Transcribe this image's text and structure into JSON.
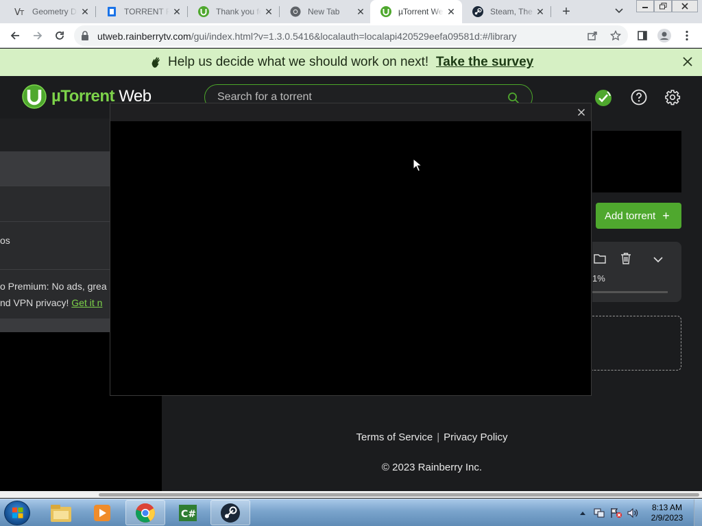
{
  "browser": {
    "tabs": [
      {
        "title": "Geometry Dash",
        "favicon": "geometry-dash-favicon",
        "active": false
      },
      {
        "title": "TORRENT FILE",
        "favicon": "document-favicon",
        "active": false
      },
      {
        "title": "Thank you for",
        "favicon": "utorrent-favicon",
        "active": false
      },
      {
        "title": "New Tab",
        "favicon": "chrome-favicon",
        "active": false
      },
      {
        "title": "µTorrent Web",
        "favicon": "utorrent-favicon",
        "active": true
      },
      {
        "title": "Steam, The Ultimate",
        "favicon": "steam-favicon",
        "active": false
      }
    ],
    "new_tab": "+",
    "url_host": "utweb.rainberrytv.com",
    "url_path": "/gui/index.html?v=1.3.0.5416&localauth=localapi420529eefa09581d:#/library"
  },
  "banner": {
    "message": "Help us decide what we should work on next!",
    "link": "Take the survey"
  },
  "app": {
    "logo_brand": "µTorrent",
    "logo_suffix": " Web",
    "search_placeholder": "Search for a torrent",
    "sidebar": {
      "item_fragment": "os",
      "promo_line1": "o Premium: No ads, grea",
      "promo_line2": "nd VPN privacy!",
      "promo_link": "Get it n"
    },
    "add_torrent": "Add torrent",
    "torrent_progress": "1%",
    "footer": {
      "terms": "Terms of Service",
      "separator": "|",
      "privacy": "Privacy Policy",
      "copyright": "© 2023 Rainberry Inc."
    }
  },
  "taskbar": {
    "time": "8:13 AM",
    "date": "2/9/2023"
  },
  "colors": {
    "accent": "#4fa82e",
    "banner_bg": "#d6f0c4",
    "app_bg": "#1b1c1e"
  }
}
